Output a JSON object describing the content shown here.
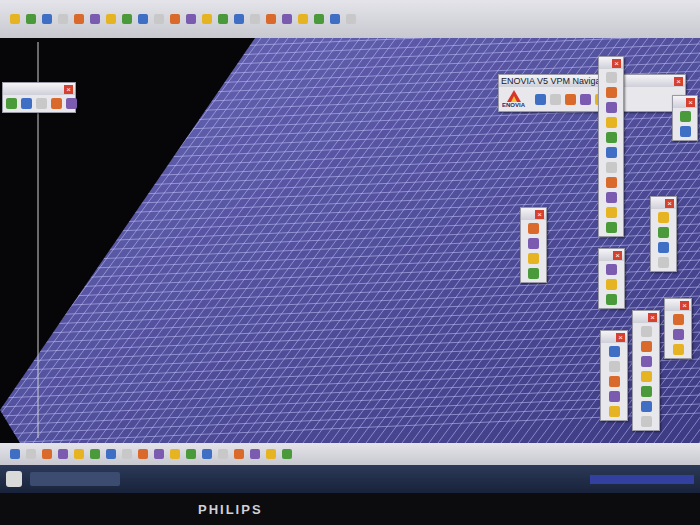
{
  "navigator": {
    "title": "ENOVIA V5 VPM Navigator",
    "logo": "ENOVIA"
  },
  "floating_toolbars": [
    {
      "close": "×"
    },
    {
      "close": "×"
    },
    {
      "close": "×"
    },
    {
      "close": "×"
    },
    {
      "close": "×"
    },
    {
      "close": "×"
    },
    {
      "close": "×"
    },
    {
      "close": "×"
    },
    {
      "close": "×"
    },
    {
      "close": "×"
    }
  ],
  "monitor": {
    "brand": "PHILIPS"
  }
}
